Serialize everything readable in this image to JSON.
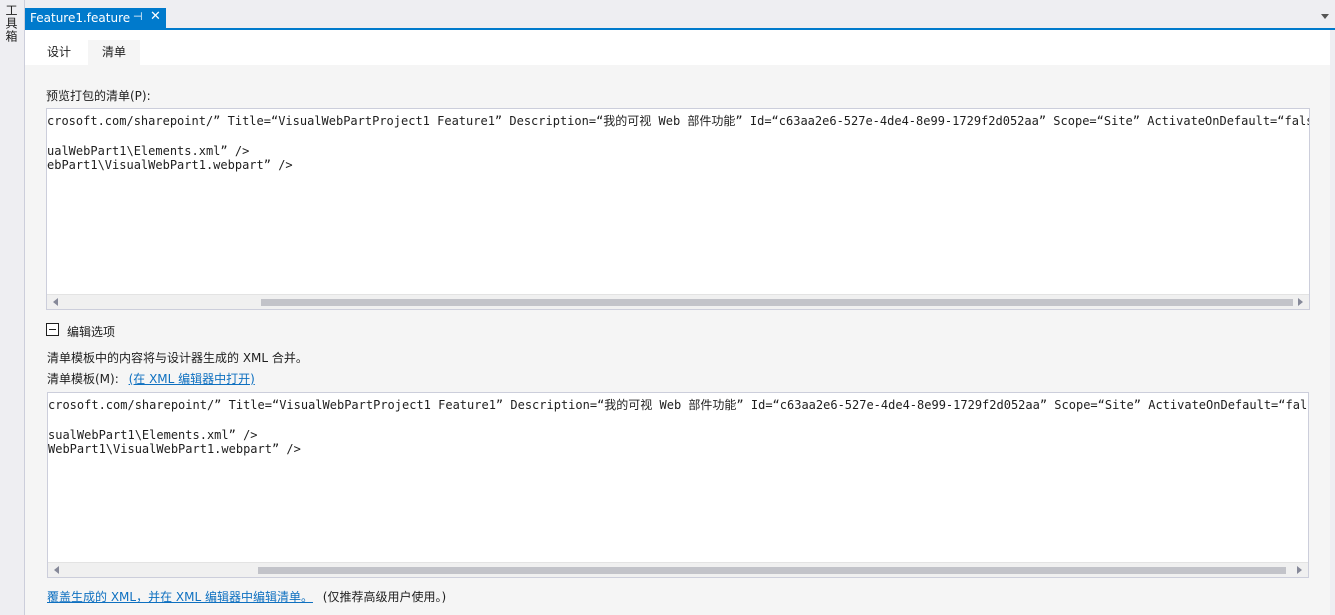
{
  "toolbox": {
    "label": "工具箱"
  },
  "document_tab": {
    "title": "Feature1.feature",
    "pin_glyph": "⊣",
    "close_glyph": "✕"
  },
  "designer_tabs": [
    {
      "label": "设计"
    },
    {
      "label": "清单"
    }
  ],
  "preview": {
    "label": "预览打包的清单(P):",
    "lines": [
      "crosoft.com/sharepoint/” Title=“VisualWebPartProject1 Feature1” Description=“我的可视 Web 部件功能” Id=“c63aa2e6-527e-4de4-8e99-1729f2d052aa” Scope=“Site” ActivateOnDefault=“false”>",
      "",
      "ualWebPart1\\Elements.xml” />",
      "ebPart1\\VisualWebPart1.webpart” />"
    ]
  },
  "edit_options": {
    "title": "编辑选项",
    "description": "清单模板中的内容将与设计器生成的 XML 合并。",
    "template_label": "清单模板(M):",
    "open_in_xml_link": "(在 XML 编辑器中打开)"
  },
  "template": {
    "lines": [
      "crosoft.com/sharepoint/” Title=“VisualWebPartProject1 Feature1” Description=“我的可视 Web 部件功能” Id=“c63aa2e6-527e-4de4-8e99-1729f2d052aa” Scope=“Site” ActivateOnDefault=“false”",
      "",
      "sualWebPart1\\Elements.xml” />",
      "WebPart1\\VisualWebPart1.webpart” />"
    ]
  },
  "footer": {
    "override_link": "覆盖生成的 XML，并在 XML 编辑器中编辑清单。",
    "note": "(仅推荐高级用户使用。)"
  },
  "colors": {
    "accent": "#007acc",
    "link": "#0e70c0",
    "background": "#eeeef2"
  }
}
